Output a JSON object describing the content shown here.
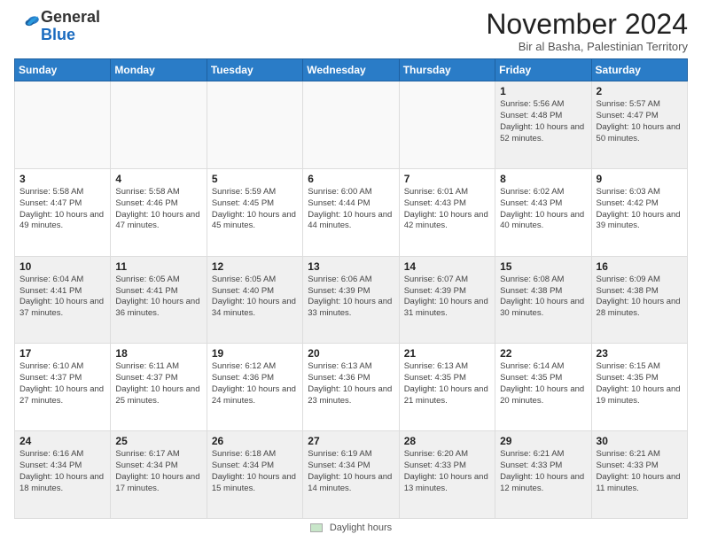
{
  "logo": {
    "general": "General",
    "blue": "Blue"
  },
  "header": {
    "month": "November 2024",
    "location": "Bir al Basha, Palestinian Territory"
  },
  "days_of_week": [
    "Sunday",
    "Monday",
    "Tuesday",
    "Wednesday",
    "Thursday",
    "Friday",
    "Saturday"
  ],
  "footer": {
    "legend_label": "Daylight hours"
  },
  "weeks": [
    [
      {
        "day": "",
        "detail": ""
      },
      {
        "day": "",
        "detail": ""
      },
      {
        "day": "",
        "detail": ""
      },
      {
        "day": "",
        "detail": ""
      },
      {
        "day": "",
        "detail": ""
      },
      {
        "day": "1",
        "detail": "Sunrise: 5:56 AM\nSunset: 4:48 PM\nDaylight: 10 hours\nand 52 minutes."
      },
      {
        "day": "2",
        "detail": "Sunrise: 5:57 AM\nSunset: 4:47 PM\nDaylight: 10 hours\nand 50 minutes."
      }
    ],
    [
      {
        "day": "3",
        "detail": "Sunrise: 5:58 AM\nSunset: 4:47 PM\nDaylight: 10 hours\nand 49 minutes."
      },
      {
        "day": "4",
        "detail": "Sunrise: 5:58 AM\nSunset: 4:46 PM\nDaylight: 10 hours\nand 47 minutes."
      },
      {
        "day": "5",
        "detail": "Sunrise: 5:59 AM\nSunset: 4:45 PM\nDaylight: 10 hours\nand 45 minutes."
      },
      {
        "day": "6",
        "detail": "Sunrise: 6:00 AM\nSunset: 4:44 PM\nDaylight: 10 hours\nand 44 minutes."
      },
      {
        "day": "7",
        "detail": "Sunrise: 6:01 AM\nSunset: 4:43 PM\nDaylight: 10 hours\nand 42 minutes."
      },
      {
        "day": "8",
        "detail": "Sunrise: 6:02 AM\nSunset: 4:43 PM\nDaylight: 10 hours\nand 40 minutes."
      },
      {
        "day": "9",
        "detail": "Sunrise: 6:03 AM\nSunset: 4:42 PM\nDaylight: 10 hours\nand 39 minutes."
      }
    ],
    [
      {
        "day": "10",
        "detail": "Sunrise: 6:04 AM\nSunset: 4:41 PM\nDaylight: 10 hours\nand 37 minutes."
      },
      {
        "day": "11",
        "detail": "Sunrise: 6:05 AM\nSunset: 4:41 PM\nDaylight: 10 hours\nand 36 minutes."
      },
      {
        "day": "12",
        "detail": "Sunrise: 6:05 AM\nSunset: 4:40 PM\nDaylight: 10 hours\nand 34 minutes."
      },
      {
        "day": "13",
        "detail": "Sunrise: 6:06 AM\nSunset: 4:39 PM\nDaylight: 10 hours\nand 33 minutes."
      },
      {
        "day": "14",
        "detail": "Sunrise: 6:07 AM\nSunset: 4:39 PM\nDaylight: 10 hours\nand 31 minutes."
      },
      {
        "day": "15",
        "detail": "Sunrise: 6:08 AM\nSunset: 4:38 PM\nDaylight: 10 hours\nand 30 minutes."
      },
      {
        "day": "16",
        "detail": "Sunrise: 6:09 AM\nSunset: 4:38 PM\nDaylight: 10 hours\nand 28 minutes."
      }
    ],
    [
      {
        "day": "17",
        "detail": "Sunrise: 6:10 AM\nSunset: 4:37 PM\nDaylight: 10 hours\nand 27 minutes."
      },
      {
        "day": "18",
        "detail": "Sunrise: 6:11 AM\nSunset: 4:37 PM\nDaylight: 10 hours\nand 25 minutes."
      },
      {
        "day": "19",
        "detail": "Sunrise: 6:12 AM\nSunset: 4:36 PM\nDaylight: 10 hours\nand 24 minutes."
      },
      {
        "day": "20",
        "detail": "Sunrise: 6:13 AM\nSunset: 4:36 PM\nDaylight: 10 hours\nand 23 minutes."
      },
      {
        "day": "21",
        "detail": "Sunrise: 6:13 AM\nSunset: 4:35 PM\nDaylight: 10 hours\nand 21 minutes."
      },
      {
        "day": "22",
        "detail": "Sunrise: 6:14 AM\nSunset: 4:35 PM\nDaylight: 10 hours\nand 20 minutes."
      },
      {
        "day": "23",
        "detail": "Sunrise: 6:15 AM\nSunset: 4:35 PM\nDaylight: 10 hours\nand 19 minutes."
      }
    ],
    [
      {
        "day": "24",
        "detail": "Sunrise: 6:16 AM\nSunset: 4:34 PM\nDaylight: 10 hours\nand 18 minutes."
      },
      {
        "day": "25",
        "detail": "Sunrise: 6:17 AM\nSunset: 4:34 PM\nDaylight: 10 hours\nand 17 minutes."
      },
      {
        "day": "26",
        "detail": "Sunrise: 6:18 AM\nSunset: 4:34 PM\nDaylight: 10 hours\nand 15 minutes."
      },
      {
        "day": "27",
        "detail": "Sunrise: 6:19 AM\nSunset: 4:34 PM\nDaylight: 10 hours\nand 14 minutes."
      },
      {
        "day": "28",
        "detail": "Sunrise: 6:20 AM\nSunset: 4:33 PM\nDaylight: 10 hours\nand 13 minutes."
      },
      {
        "day": "29",
        "detail": "Sunrise: 6:21 AM\nSunset: 4:33 PM\nDaylight: 10 hours\nand 12 minutes."
      },
      {
        "day": "30",
        "detail": "Sunrise: 6:21 AM\nSunset: 4:33 PM\nDaylight: 10 hours\nand 11 minutes."
      }
    ]
  ]
}
